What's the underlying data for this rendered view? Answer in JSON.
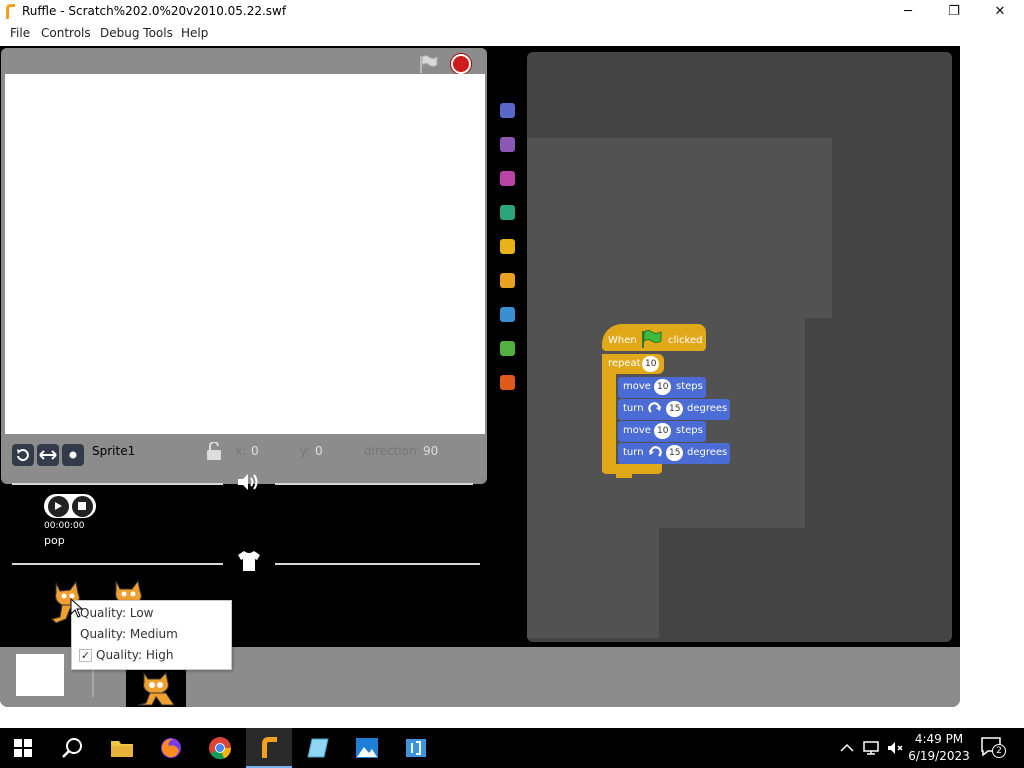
{
  "window": {
    "title": "Ruffle - Scratch%202.0%20v2010.05.22.swf",
    "minimize_glyph": "─",
    "maximize_glyph": "❐",
    "close_glyph": "✕"
  },
  "menubar": {
    "items": [
      "File",
      "Controls",
      "Debug Tools",
      "Help"
    ]
  },
  "sprite_info": {
    "name": "Sprite1",
    "x_label": "x:",
    "x_value": "0",
    "y_label": "y:",
    "y_value": "0",
    "direction_label": "direction:",
    "direction_value": "90"
  },
  "sound": {
    "time": "00:00:00",
    "name": "pop"
  },
  "script": {
    "hat_when": "When",
    "hat_clicked": "clicked",
    "repeat_label": "repeat",
    "repeat_count": "10",
    "blocks": [
      {
        "verb": "move",
        "value": "10",
        "unit": "steps"
      },
      {
        "verb": "turn",
        "value": "15",
        "unit": "degrees",
        "rotation": "clockwise"
      },
      {
        "verb": "move",
        "value": "10",
        "unit": "steps"
      },
      {
        "verb": "turn",
        "value": "15",
        "unit": "degrees",
        "rotation": "counterclockwise"
      }
    ]
  },
  "categories": {
    "colors": [
      "#5b67c8",
      "#8a58b3",
      "#b844a5",
      "#2ca57a",
      "#e8b219",
      "#e8a120",
      "#3a8fd3",
      "#52b040",
      "#e05a19"
    ]
  },
  "context_menu": {
    "items": [
      {
        "label": "Quality: Low",
        "checked": false
      },
      {
        "label": "Quality: Medium",
        "checked": false
      },
      {
        "label": "Quality: High",
        "checked": true
      }
    ]
  },
  "taskbar": {
    "apps": [
      "start-icon",
      "search-icon",
      "file-explorer-icon",
      "firefox-icon",
      "chrome-icon",
      "ruffle-icon",
      "notepad-icon",
      "photos-icon",
      "visual-studio-icon"
    ],
    "time": "4:49 PM",
    "date": "6/19/2023",
    "notification_count": "2"
  },
  "colors": {
    "motion_block": "#4a6cd4",
    "control_block": "#e1a91a",
    "script_area": "#444444",
    "stage_frame": "#8c8c8c"
  }
}
